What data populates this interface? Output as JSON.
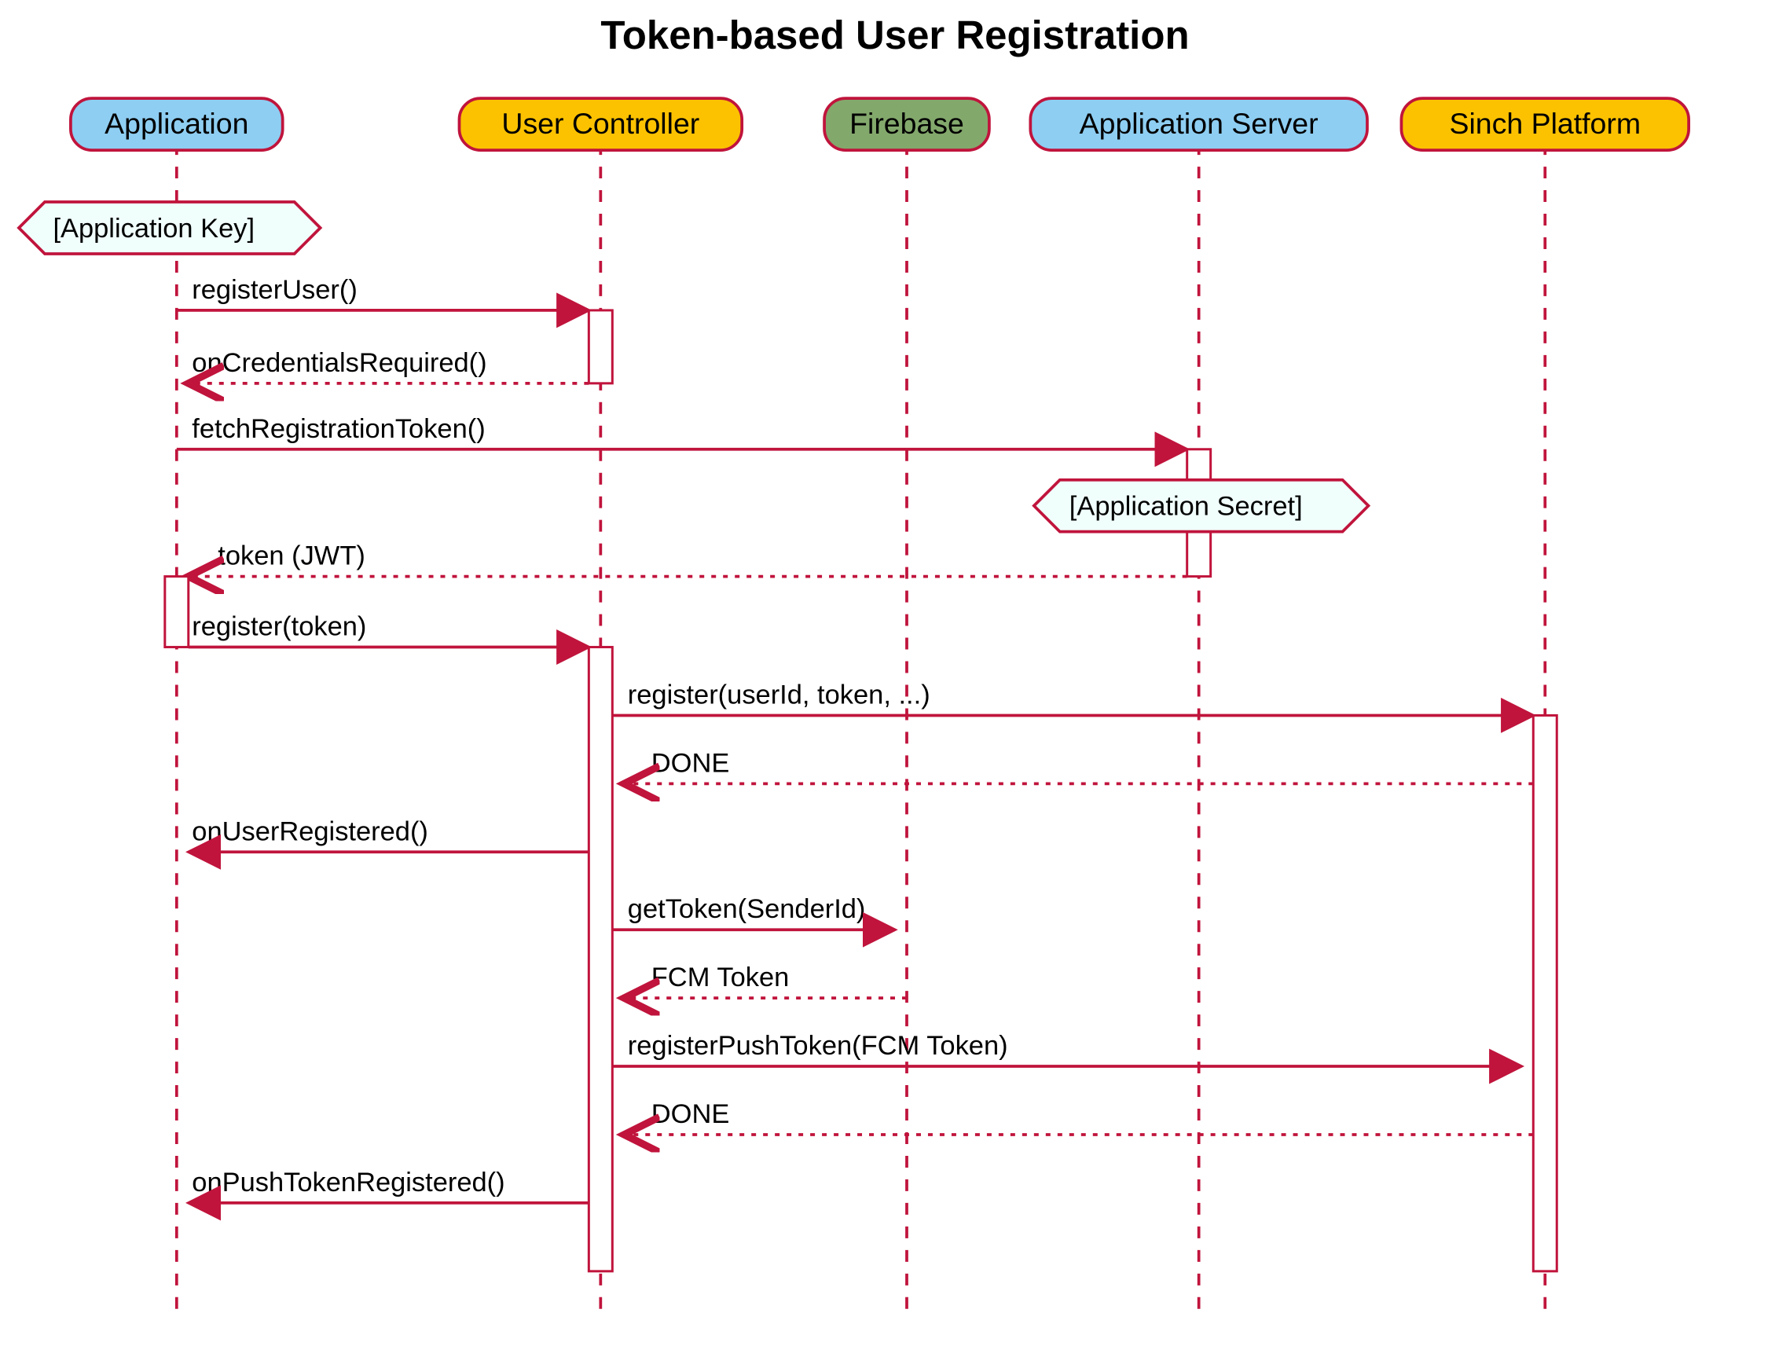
{
  "title": "Token-based User Registration",
  "participants": [
    {
      "id": "app",
      "label": "Application",
      "fill": "#8ecef2"
    },
    {
      "id": "uc",
      "label": "User Controller",
      "fill": "#fcc200"
    },
    {
      "id": "fb",
      "label": "Firebase",
      "fill": "#83a86c"
    },
    {
      "id": "appsrv",
      "label": "Application Server",
      "fill": "#8ecef2"
    },
    {
      "id": "sinch",
      "label": "Sinch Platform",
      "fill": "#fcc200"
    }
  ],
  "notes": [
    {
      "id": "n1",
      "text": "[Application Key]"
    },
    {
      "id": "n2",
      "text": "[Application Secret]"
    }
  ],
  "messages": [
    {
      "id": "m1",
      "text": "registerUser()"
    },
    {
      "id": "m2",
      "text": "onCredentialsRequired()"
    },
    {
      "id": "m3",
      "text": "fetchRegistrationToken()"
    },
    {
      "id": "m4",
      "text": "token (JWT)"
    },
    {
      "id": "m5",
      "text": "register(token)"
    },
    {
      "id": "m6",
      "text": "register(userId, token, ...)"
    },
    {
      "id": "m7",
      "text": "DONE"
    },
    {
      "id": "m8",
      "text": "onUserRegistered()"
    },
    {
      "id": "m9",
      "text": "getToken(SenderId)"
    },
    {
      "id": "m10",
      "text": "FCM Token"
    },
    {
      "id": "m11",
      "text": "registerPushToken(FCM Token)"
    },
    {
      "id": "m12",
      "text": "DONE"
    },
    {
      "id": "m13",
      "text": "onPushTokenRegistered()"
    }
  ]
}
